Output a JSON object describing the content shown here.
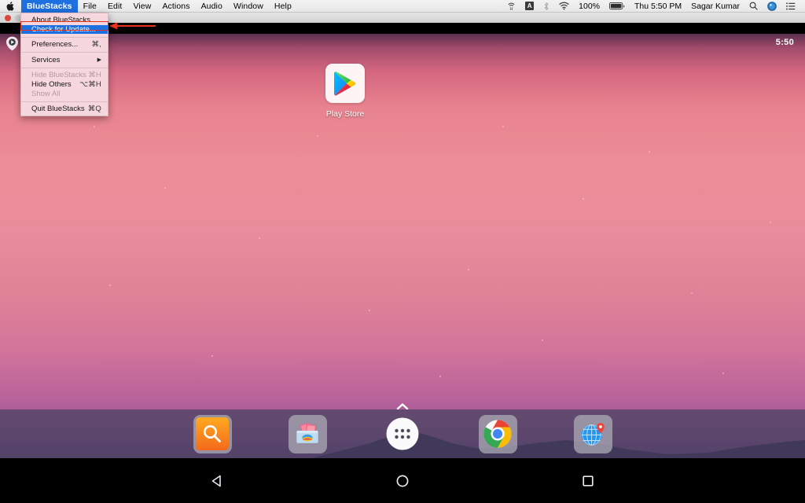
{
  "menubar": {
    "apple_icon": "apple-logo-icon",
    "items": [
      {
        "label": "BlueStacks",
        "active": true,
        "bold": true
      },
      {
        "label": "File",
        "active": false,
        "bold": false
      },
      {
        "label": "Edit",
        "active": false,
        "bold": false
      },
      {
        "label": "View",
        "active": false,
        "bold": false
      },
      {
        "label": "Actions",
        "active": false,
        "bold": false
      },
      {
        "label": "Audio",
        "active": false,
        "bold": false
      },
      {
        "label": "Window",
        "active": false,
        "bold": false
      },
      {
        "label": "Help",
        "active": false,
        "bold": false
      }
    ],
    "status": {
      "hotspot_icon": "hotspot-tethering-icon",
      "input_source": "A",
      "bluetooth_icon": "bluetooth-icon",
      "wifi_icon": "wifi-icon",
      "battery_percent": "100%",
      "battery_icon": "battery-full-icon",
      "clock": "Thu 5:50 PM",
      "user": "Sagar Kumar",
      "search_icon": "spotlight-search-icon",
      "siri_icon": "siri-icon",
      "control_center_icon": "notification-center-icon"
    }
  },
  "dropdown": {
    "title": "BlueStacks",
    "items": [
      {
        "label": "About BlueStacks",
        "shortcut": "",
        "selected": false,
        "disabled": false,
        "submenu": false
      },
      {
        "label": "Check for Update...",
        "shortcut": "",
        "selected": true,
        "disabled": false,
        "submenu": false
      },
      {
        "sep": true
      },
      {
        "label": "Preferences...",
        "shortcut": "⌘,",
        "selected": false,
        "disabled": false,
        "submenu": false
      },
      {
        "sep": true
      },
      {
        "label": "Services",
        "shortcut": "",
        "selected": false,
        "disabled": false,
        "submenu": true
      },
      {
        "sep": true
      },
      {
        "label": "Hide BlueStacks",
        "shortcut": "⌘H",
        "selected": false,
        "disabled": true,
        "submenu": false
      },
      {
        "label": "Hide Others",
        "shortcut": "⌥⌘H",
        "selected": false,
        "disabled": false,
        "submenu": false
      },
      {
        "label": "Show All",
        "shortcut": "",
        "selected": false,
        "disabled": true,
        "submenu": false
      },
      {
        "sep": true
      },
      {
        "label": "Quit BlueStacks",
        "shortcut": "⌘Q",
        "selected": false,
        "disabled": false,
        "submenu": false
      }
    ]
  },
  "annotation": {
    "highlight_color": "#e8301b",
    "arrow_direction": "left",
    "target": "Check for Update..."
  },
  "window": {
    "traffic_lights": [
      "close",
      "minimize",
      "zoom"
    ],
    "app_logo_icon": "bluestacks-play-logo-icon"
  },
  "android": {
    "status_bar": {
      "clock": "5:50"
    },
    "desktop_apps": [
      {
        "label": "Play Store",
        "icon": "google-play-store-icon"
      }
    ],
    "drawer_handle_icon": "chevron-up-icon",
    "dock": [
      {
        "name": "search",
        "icon": "search-magnifier-icon",
        "tile": true
      },
      {
        "name": "gallery",
        "icon": "gallery-photos-icon",
        "tile": true
      },
      {
        "name": "app-drawer",
        "icon": "app-drawer-dots-icon",
        "tile": false
      },
      {
        "name": "chrome",
        "icon": "google-chrome-icon",
        "tile": true
      },
      {
        "name": "browser",
        "icon": "globe-location-icon",
        "tile": true
      }
    ],
    "nav": [
      {
        "name": "back",
        "icon": "back-triangle-icon"
      },
      {
        "name": "home",
        "icon": "home-circle-icon"
      },
      {
        "name": "recents",
        "icon": "recents-square-icon"
      }
    ]
  },
  "colors": {
    "menu_highlight": "#1e6fe0",
    "annotation_red": "#e8301b",
    "menu_bg": "#f5d7dd",
    "dock_bg": "#484260",
    "wallpaper_pink": "#ec8d97",
    "wallpaper_purple": "#3a2a55"
  }
}
